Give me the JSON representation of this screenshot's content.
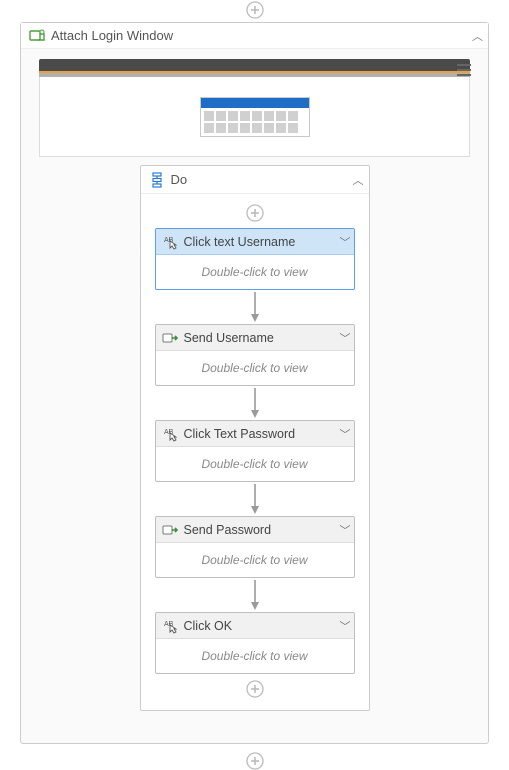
{
  "outer": {
    "title": "Attach Login Window"
  },
  "do": {
    "title": "Do"
  },
  "hint": "Double-click to view",
  "activities": [
    {
      "title": "Click text Username",
      "type": "click-text",
      "selected": true
    },
    {
      "title": "Send Username",
      "type": "send",
      "selected": false
    },
    {
      "title": "Click Text Password",
      "type": "click-text",
      "selected": false
    },
    {
      "title": "Send Password",
      "type": "send",
      "selected": false
    },
    {
      "title": "Click OK",
      "type": "click-text",
      "selected": false
    }
  ]
}
